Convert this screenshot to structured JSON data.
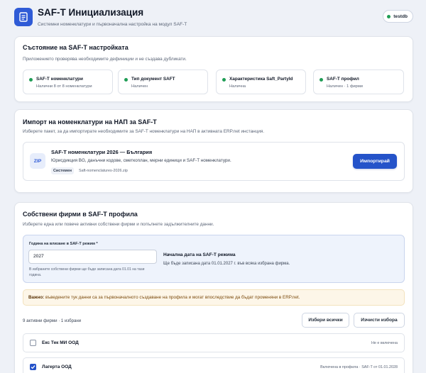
{
  "header": {
    "title": "SAF-T Инициализация",
    "subtitle": "Системни номенклатури и първоначална настройка на модул SAF-T",
    "db_name": "testdb",
    "logo_icon": "document-icon"
  },
  "status_card": {
    "title": "Състояние на SAF-T настройката",
    "description": "Приложението проверява необходимите дефиниции и не създава дубликати.",
    "items": [
      {
        "name": "SAF-T номенклатури",
        "value": "Налични 8 от 8 номенклатури"
      },
      {
        "name": "Тип документ SAFT",
        "value": "Наличен"
      },
      {
        "name": "Характеристика Saft_PartyId",
        "value": "Налична"
      },
      {
        "name": "SAF-T профил",
        "value": "Наличен · 1 фирми"
      }
    ],
    "status_color": "#1f9d55"
  },
  "import_card": {
    "title": "Импорт на номенклатури на НАП за SAF-T",
    "description": "Изберете пакет, за да импортирате необходимите за SAF-T номенклатури на НАП в активната ERP.net инстанция.",
    "package": {
      "badge": "ZIP",
      "title": "SAF-T номенклатури 2026 — България",
      "description": "Юрисдикция BG, данъчни кодове, сметкоплан, мерни единици и SAF-T номенклатури.",
      "tag": "Системен",
      "file": "Saft-nomenclatures-2026.zip"
    },
    "import_button": "Импортирай"
  },
  "firms_card": {
    "title": "Собствени фирми в SAF-T профила",
    "description": "Изберете една или повече активни собствени фирми и попълнете задължителните данни.",
    "date_panel": {
      "label": "Година на влизане в SAF-T режим *",
      "value": "2027",
      "help": "В избраните собствени фирми ще бъде записана дата 01.01 на тази година.",
      "start_title": "Начална дата на SAF-T режима",
      "start_desc": "Ще бъде записана дата 01.01.2027 г. във всяка избрана фирма."
    },
    "warning": {
      "bold": "Важно:",
      "text": " въведените тук данни са за първоначалното създаване на профила и могат впоследствие да бъдат променяни в ERP.net."
    },
    "count": "9 активни фирми · 1 избрани",
    "select_all": "Избери всички",
    "clear_selection": "Изчисти избора",
    "firms": [
      {
        "name": "Екс Тек МИ ООД",
        "status": "Не е включена",
        "checked": false
      },
      {
        "name": "Лагерта ООД",
        "status": "Включена в профила · SAF-T от 01.01.2028",
        "checked": true
      }
    ]
  },
  "colors": {
    "accent": "#2553c9",
    "background": "#eef1f7",
    "warning_bg": "#fdf6e8"
  }
}
